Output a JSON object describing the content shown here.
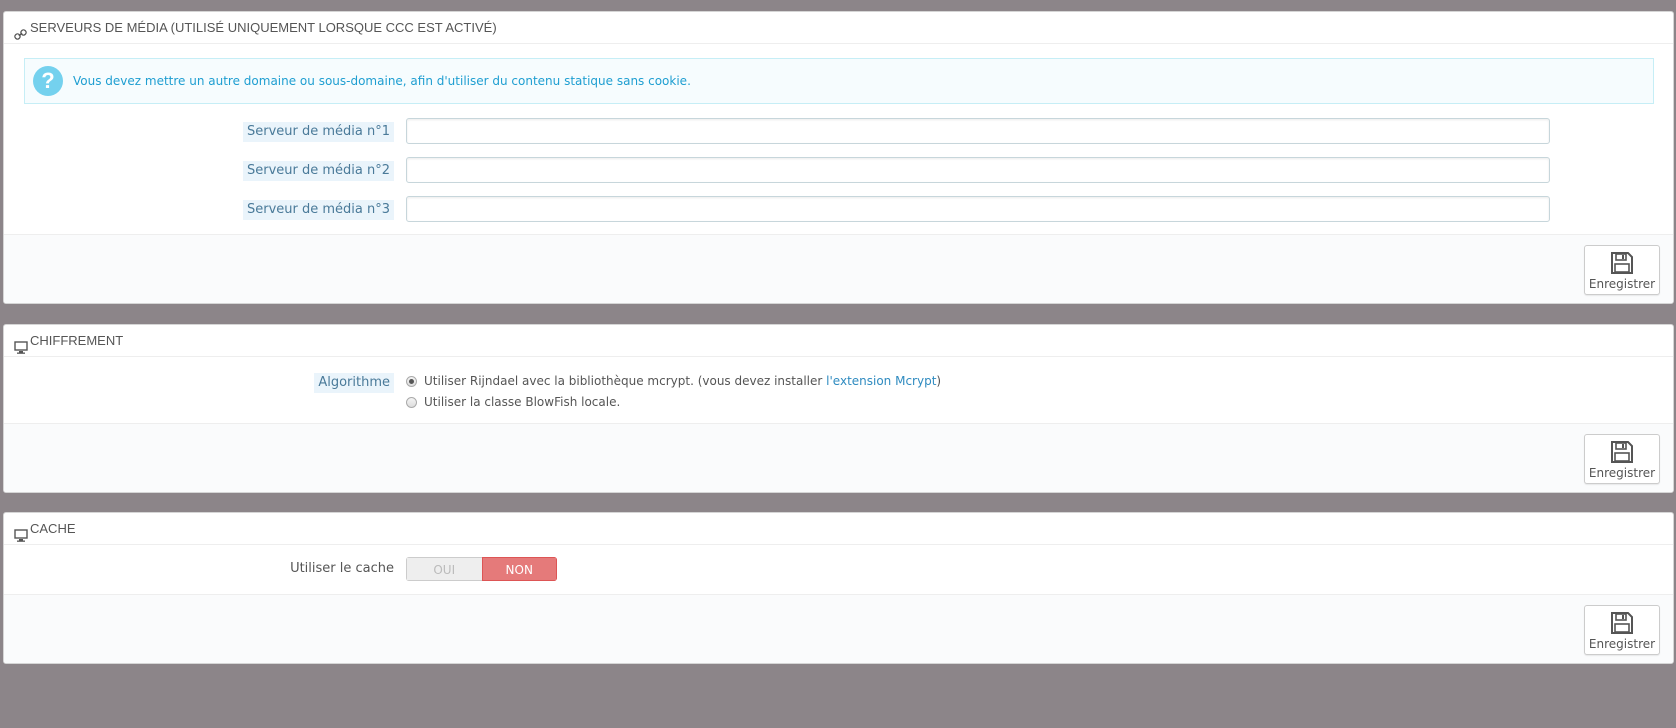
{
  "media_panel": {
    "title": "SERVEURS DE MÉDIA (UTILISÉ UNIQUEMENT LORSQUE CCC EST ACTIVÉ)",
    "heading_icon": "link-icon",
    "alert": "Vous devez mettre un autre domaine ou sous-domaine, afin d'utiliser du contenu statique sans cookie.",
    "fields": [
      {
        "label": "Serveur de média n°1",
        "value": ""
      },
      {
        "label": "Serveur de média n°2",
        "value": ""
      },
      {
        "label": "Serveur de média n°3",
        "value": ""
      }
    ],
    "save_label": "Enregistrer"
  },
  "cipher_panel": {
    "title": "CHIFFREMENT",
    "heading_icon": "monitor-icon",
    "algorithm_label": "Algorithme",
    "options": [
      {
        "text_before": "Utiliser Rijndael avec la bibliothèque mcrypt. (vous devez installer ",
        "link": "l'extension Mcrypt",
        "text_after": ")",
        "checked": true
      },
      {
        "text_before": "Utiliser la classe BlowFish locale.",
        "link": "",
        "text_after": "",
        "checked": false
      }
    ],
    "save_label": "Enregistrer"
  },
  "cache_panel": {
    "title": "CACHE",
    "heading_icon": "monitor-icon",
    "use_cache_label": "Utiliser le cache",
    "switch_off_label": "OUI",
    "switch_on_label": "NON",
    "selected": "NON",
    "save_label": "Enregistrer"
  },
  "colors": {
    "page_bg": "#8c8589",
    "alert_text": "#1e9ed1",
    "switch_active": "#e57a7a",
    "link": "#2f8bc0"
  }
}
